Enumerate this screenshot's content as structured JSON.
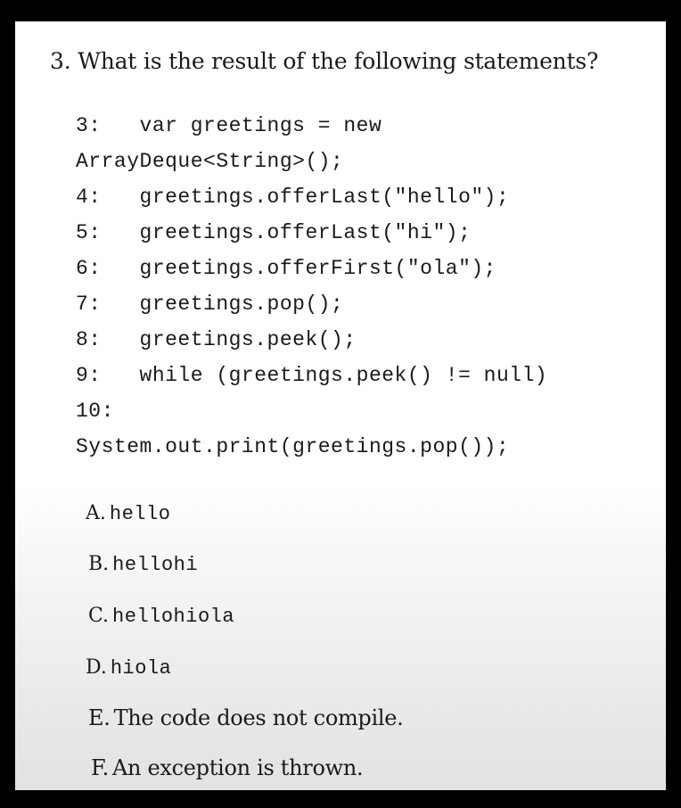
{
  "question": {
    "text": "3. What is the result of the following statements?"
  },
  "code_lines": [
    "3:   var greetings = new",
    "ArrayDeque<String>();",
    "4:   greetings.offerLast(\"hello\");",
    "5:   greetings.offerLast(\"hi\");",
    "6:   greetings.offerFirst(\"ola\");",
    "7:   greetings.pop();",
    "8:   greetings.peek();",
    "9:   while (greetings.peek() != null)",
    "10:",
    "System.out.print(greetings.pop());"
  ],
  "options": [
    {
      "letter": "A.",
      "text": "hello"
    },
    {
      "letter": "B.",
      "text": "hellohi"
    },
    {
      "letter": "C.",
      "text": "hellohiola"
    },
    {
      "letter": "D.",
      "text": "hiola"
    },
    {
      "letter": "E.",
      "text": "The code does not compile."
    },
    {
      "letter": "F.",
      "text": "An exception is thrown."
    }
  ]
}
